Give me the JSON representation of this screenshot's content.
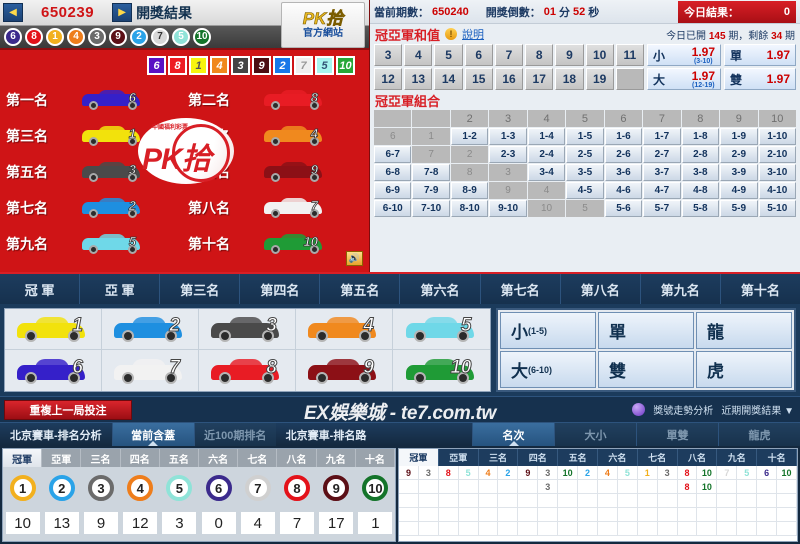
{
  "header": {
    "prev_issue": "650239",
    "result_title": "開獎結果",
    "logo_top": "PK拾",
    "logo_bottom": "官方網站",
    "logo_mini": "中國福利彩票",
    "pk_text": "PK拾",
    "current_issue_label": "當前期數：",
    "current_issue": "650240",
    "countdown_label": "開獎倒數：",
    "countdown_min": "01",
    "countdown_min_unit": "分",
    "countdown_sec": "52",
    "countdown_sec_unit": "秒",
    "today_result_label": "今日結果：",
    "today_result_value": "0",
    "prev_arrow": "◀",
    "next_arrow": "▶",
    "sound_icon": "🔊"
  },
  "draw_balls": [
    6,
    8,
    1,
    4,
    3,
    9,
    2,
    7,
    5,
    10
  ],
  "rankings": [
    {
      "label": "第一名",
      "car": 6
    },
    {
      "label": "第二名",
      "car": 8
    },
    {
      "label": "第三名",
      "car": 1
    },
    {
      "label": "第四名",
      "car": 4
    },
    {
      "label": "第五名",
      "car": 3
    },
    {
      "label": "第六名",
      "car": 9
    },
    {
      "label": "第七名",
      "car": 2
    },
    {
      "label": "第八名",
      "car": 7
    },
    {
      "label": "第九名",
      "car": 5
    },
    {
      "label": "第十名",
      "car": 10
    }
  ],
  "sum_section": {
    "title": "冠亞軍和值",
    "help_label": "說明",
    "info_icon": "!",
    "opened_prefix": "今日已開",
    "opened_count": "145",
    "opened_mid": "期，剩餘",
    "remain_count": "34",
    "opened_suffix": "期",
    "row1": [
      "3",
      "4",
      "5",
      "6",
      "7",
      "8",
      "9",
      "10",
      "11"
    ],
    "row2": [
      "12",
      "13",
      "14",
      "15",
      "16",
      "17",
      "18",
      "19",
      ""
    ],
    "small": {
      "key": "小",
      "odds": "1.97",
      "range": "(3-10)"
    },
    "big": {
      "key": "大",
      "odds": "1.97",
      "range": "(12-19)"
    },
    "odd": {
      "key": "單",
      "odds": "1.97"
    },
    "even": {
      "key": "雙",
      "odds": "1.97"
    }
  },
  "combo_section": {
    "title": "冠亞軍組合",
    "col_headers": [
      "",
      "",
      "2",
      "3",
      "4",
      "5",
      "6",
      "7",
      "8",
      "9",
      "10"
    ],
    "rows": [
      [
        "6",
        "1",
        "1-2",
        "1-3",
        "1-4",
        "1-5",
        "1-6",
        "1-7",
        "1-8",
        "1-9",
        "1-10"
      ],
      [
        "6-7",
        "7",
        "2",
        "2-3",
        "2-4",
        "2-5",
        "2-6",
        "2-7",
        "2-8",
        "2-9",
        "2-10"
      ],
      [
        "6-8",
        "7-8",
        "8",
        "3",
        "3-4",
        "3-5",
        "3-6",
        "3-7",
        "3-8",
        "3-9",
        "3-10"
      ],
      [
        "6-9",
        "7-9",
        "8-9",
        "9",
        "4",
        "4-5",
        "4-6",
        "4-7",
        "4-8",
        "4-9",
        "4-10"
      ],
      [
        "6-10",
        "7-10",
        "8-10",
        "9-10",
        "10",
        "5",
        "5-6",
        "5-7",
        "5-8",
        "5-9",
        "5-10"
      ]
    ],
    "disabled": [
      [
        true,
        true,
        false,
        false,
        false,
        false,
        false,
        false,
        false,
        false,
        false
      ],
      [
        false,
        true,
        true,
        false,
        false,
        false,
        false,
        false,
        false,
        false,
        false
      ],
      [
        false,
        false,
        true,
        true,
        false,
        false,
        false,
        false,
        false,
        false,
        false
      ],
      [
        false,
        false,
        false,
        true,
        true,
        false,
        false,
        false,
        false,
        false,
        false
      ],
      [
        false,
        false,
        false,
        false,
        true,
        true,
        false,
        false,
        false,
        false,
        false
      ]
    ]
  },
  "position_tabs": [
    {
      "label": "冠 軍",
      "active": false
    },
    {
      "label": "亞 軍",
      "active": false
    },
    {
      "label": "第三名",
      "active": false
    },
    {
      "label": "第四名",
      "active": false
    },
    {
      "label": "第五名",
      "active": false
    },
    {
      "label": "第六名",
      "active": false
    },
    {
      "label": "第七名",
      "active": false
    },
    {
      "label": "第八名",
      "active": false
    },
    {
      "label": "第九名",
      "active": false
    },
    {
      "label": "第十名",
      "active": false
    }
  ],
  "car_picks": [
    1,
    2,
    3,
    4,
    5,
    6,
    7,
    8,
    9,
    10
  ],
  "side_options": [
    {
      "big": "小",
      "range": "(1-5)"
    },
    {
      "big": "單",
      "range": ""
    },
    {
      "big": "龍",
      "range": ""
    },
    {
      "big": "大",
      "range": "(6-10)"
    },
    {
      "big": "雙",
      "range": ""
    },
    {
      "big": "虎",
      "range": ""
    }
  ],
  "watermark_bar": {
    "repeat_label": "重複上一局投注",
    "watermark": "EX娛樂城 - te7.com.tw",
    "trend_link": "獎號走勢分析",
    "recent_link": "近期開獎結果 ▼"
  },
  "analysis_bar": {
    "left_title": "北京賽車-排名分析",
    "left_tabs": [
      {
        "label": "當前含蓋",
        "active": true
      },
      {
        "label": "近100期排名",
        "active": false
      }
    ],
    "right_title": "北京賽車-排名路",
    "right_tabs": [
      {
        "label": "名次",
        "active": true
      },
      {
        "label": "大小",
        "active": false
      },
      {
        "label": "單雙",
        "active": false
      },
      {
        "label": "龍虎",
        "active": false
      }
    ]
  },
  "bottom_left": {
    "tabs": [
      {
        "label": "冠軍",
        "active": true
      },
      {
        "label": "亞軍",
        "active": false
      },
      {
        "label": "三名",
        "active": false
      },
      {
        "label": "四名",
        "active": false
      },
      {
        "label": "五名",
        "active": false
      },
      {
        "label": "六名",
        "active": false
      },
      {
        "label": "七名",
        "active": false
      },
      {
        "label": "八名",
        "active": false
      },
      {
        "label": "九名",
        "active": false
      },
      {
        "label": "十名",
        "active": false
      }
    ],
    "balls": [
      1,
      2,
      3,
      4,
      5,
      6,
      7,
      8,
      9,
      10
    ],
    "counts": [
      "10",
      "13",
      "9",
      "12",
      "3",
      "0",
      "4",
      "7",
      "17",
      "1"
    ]
  },
  "bottom_right": {
    "tabs": [
      {
        "label": "冠軍",
        "active": true
      },
      {
        "label": "亞軍",
        "active": false
      },
      {
        "label": "三名",
        "active": false
      },
      {
        "label": "四名",
        "active": false
      },
      {
        "label": "五名",
        "active": false
      },
      {
        "label": "六名",
        "active": false
      },
      {
        "label": "七名",
        "active": false
      },
      {
        "label": "八名",
        "active": false
      },
      {
        "label": "九名",
        "active": false
      },
      {
        "label": "十名",
        "active": false
      }
    ],
    "grid_rows": [
      [
        "9",
        "3",
        "8",
        "5",
        "4",
        "2",
        "9",
        "3",
        "10",
        "2",
        "4",
        "5",
        "1",
        "3",
        "8",
        "10",
        "7",
        "5",
        "6",
        "10"
      ],
      [
        "",
        "",
        "",
        "",
        "",
        "",
        "",
        "3",
        "",
        "",
        "",
        "",
        "",
        "",
        "8",
        "10",
        "",
        "",
        "",
        ""
      ],
      [
        "",
        "",
        "",
        "",
        "",
        "",
        "",
        "",
        "",
        "",
        "",
        "",
        "",
        "",
        "",
        "",
        "",
        "",
        "",
        ""
      ],
      [
        "",
        "",
        "",
        "",
        "",
        "",
        "",
        "",
        "",
        "",
        "",
        "",
        "",
        "",
        "",
        "",
        "",
        "",
        "",
        ""
      ],
      [
        "",
        "",
        "",
        "",
        "",
        "",
        "",
        "",
        "",
        "",
        "",
        "",
        "",
        "",
        "",
        "",
        "",
        "",
        "",
        ""
      ]
    ],
    "extra_cols": [
      "6"
    ]
  },
  "colors": {
    "red_panel": "#cf1416",
    "navy": "#16314e",
    "accent_blue": "#2f5f93",
    "odds_red": "#cc0000",
    "ball_colors": {
      "1": "#f2b01e",
      "2": "#2aa3e8",
      "3": "#6b6b6b",
      "4": "#ee7d1b",
      "5": "#8fe3d8",
      "6": "#3b2a8c",
      "7": "#d8d8d8",
      "8": "#e3121a",
      "9": "#5c0f16",
      "10": "#14742a"
    }
  }
}
